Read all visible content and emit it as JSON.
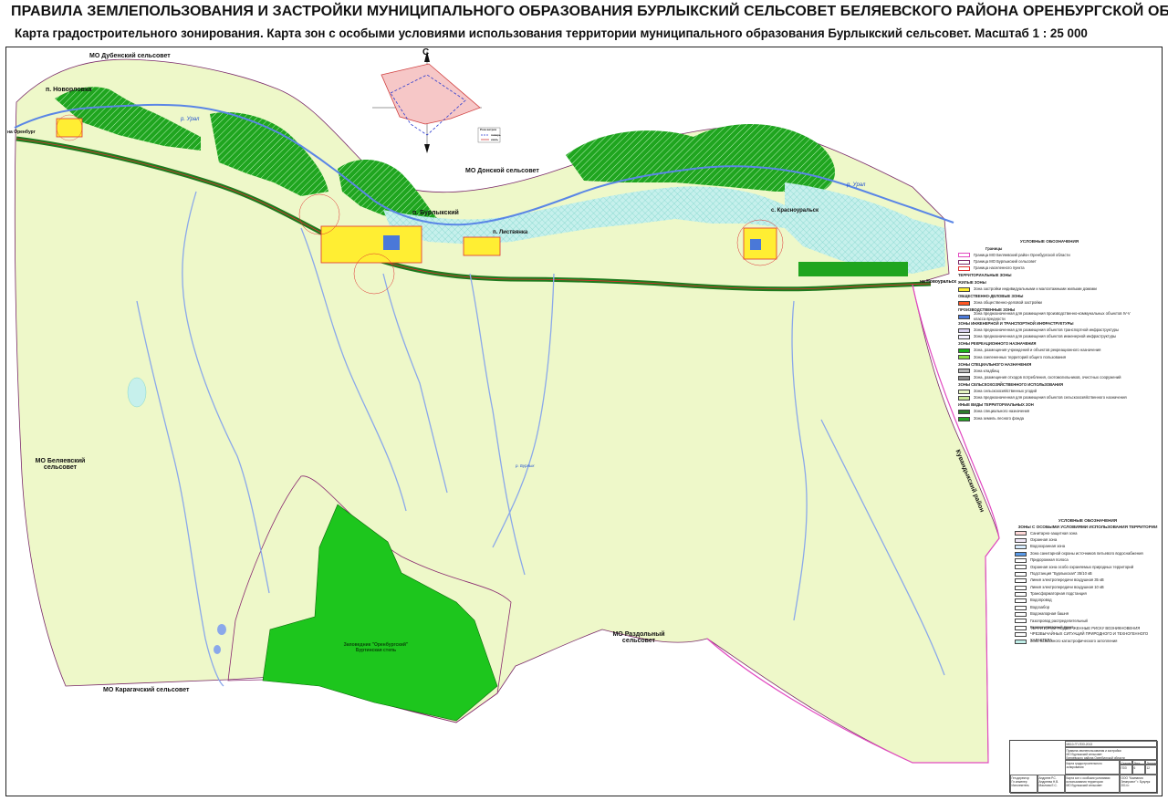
{
  "title": "ПРАВИЛА ЗЕМЛЕПОЛЬЗОВАНИЯ И ЗАСТРОЙКИ МУНИЦИПАЛЬНОГО ОБРАЗОВАНИЯ БУРЛЫКСКИЙ СЕЛЬСОВЕТ БЕЛЯЕВСКОГО РАЙОНА ОРЕНБУРГСКОЙ ОБЛАСТИ",
  "subtitle": "Карта градостроительного зонирования. Карта зон с особыми условиями использования территории муниципального образования Бурлыкский сельсовет. Масштаб 1 : 25 000",
  "map": {
    "neighbors": {
      "dubensky": "МО Дубенский сельсовет",
      "donskoy": "МО Донской сельсовет",
      "belyaevsky": "МО Беляевский сельсовет",
      "karagachsky": "МО Карагачский сельсовет",
      "razdolny": "МО Раздольный сельсовет",
      "kuvandyk": "Кувандыкский район"
    },
    "settlements": {
      "novorlovka": "п. Новорловка",
      "burlyksky": "п. Бурлыкский",
      "listvyanka": "п. Листвянка",
      "krasnouralsk": "с. Красноуральск"
    },
    "rivers": {
      "ural_west": "р. Урал",
      "ural_east": "р. Урал",
      "burlyk": "р. Бурлык"
    },
    "roads": {
      "to_orenburg": "на Оренбург",
      "to_novouralsk": "на Новоуральск"
    },
    "reserve": "Заповедник \"Оренбургский\" Буртинская степь",
    "compass_letter": "С",
    "wind_rose_legend": {
      "title": "Роза ветров",
      "item1": "январь",
      "item2": "июль"
    }
  },
  "legend1": {
    "title": "УСЛОВНЫЕ ОБОЗНАЧЕНИЯ",
    "borders_head": "Границы",
    "borders": [
      {
        "label": "Граница МО Беляевский район Оренбургской области",
        "color": "#e24ac0"
      },
      {
        "label": "Граница МО Бурлыкский сельсовет",
        "color": "#7a2a6a"
      },
      {
        "label": "Граница населенного пункта",
        "color": "#e03030"
      }
    ],
    "zones_head": "ТЕРРИТОРИАЛЬНЫЕ ЗОНЫ",
    "zones": [
      {
        "section": "ЖИЛЫЕ ЗОНЫ",
        "label": "Зона застройки индивидуальными и малоэтажными жилыми домами",
        "color": "#ffee33"
      },
      {
        "section": "ОБЩЕСТВЕННО-ДЕЛОВЫЕ ЗОНЫ",
        "label": "Зона общественно-деловой застройки",
        "color": "#ff5522"
      },
      {
        "section": "ПРОИЗВОДСТВЕННЫЕ ЗОНЫ",
        "label": "Зона предназначенная для размещения производственно-коммунальных объектов IV-V класса вредности",
        "color": "#4a78d8"
      },
      {
        "section": "ЗОНЫ ИНЖЕНЕРНОЙ И ТРАНСПОРТНОЙ ИНФРАСТРУКТУРЫ",
        "label": "Зона предназначенная для размещения объектов транспортной инфраструктуры",
        "color": "#d8d0ee"
      },
      {
        "section": "",
        "label": "Зона предназначенная для размещения объектов инженерной инфраструктуры",
        "color": "#f4f0ff"
      },
      {
        "section": "ЗОНЫ РЕКРЕАЦИОННОГО НАЗНАЧЕНИЯ",
        "label": "Зона, размещения учреждений и объектов рекреационного назначения",
        "color": "#1bb21b"
      },
      {
        "section": "",
        "label": "Зона озелененных территорий общего пользования",
        "color": "#88dd44"
      },
      {
        "section": "ЗОНЫ СПЕЦИАЛЬНОГО НАЗНАЧЕНИЯ",
        "label": "Зона кладбищ",
        "color": "#b8b8b8"
      },
      {
        "section": "",
        "label": "Зона, размещения отходов потребления, скотомогильников, очистных сооружений",
        "color": "#8e8e8e"
      },
      {
        "section": "ЗОНЫ СЕЛЬСКОХОЗЯЙСТВЕННОГО ИСПОЛЬЗОВАНИЯ",
        "label": "Зона сельскохозяйственных угодий",
        "color": "#e6f5c2"
      },
      {
        "section": "",
        "label": "Зона предназначенная для размещения объектов сельскохозяйственного назначения",
        "color": "#c8e896"
      },
      {
        "section": "ИНЫЕ ВИДЫ ТЕРРИТОРИАЛЬНЫХ ЗОН",
        "label": "Зона специального назначения",
        "color": "#2a7a2a"
      },
      {
        "section": "",
        "label": "Зона земель лесного фонда",
        "color": "#22a422"
      }
    ]
  },
  "legend2": {
    "title": "УСЛОВНЫЕ ОБОЗНАЧЕНИЯ",
    "subtitle": "ЗОНЫ С ОСОБЫМИ УСЛОВИЯМИ ИСПОЛЬЗОВАНИЯ ТЕРРИТОРИИ",
    "items": [
      {
        "label": "Санитарно-защитная зона",
        "color": "#ffd8d8"
      },
      {
        "label": "Охранная зона",
        "color": "#f0e8f8"
      },
      {
        "label": "Водоохранная зона",
        "color": "#d8ecff"
      },
      {
        "label": "Зона санитарной охраны источников питьевого водоснабжения",
        "color": "#5a9ae8"
      },
      {
        "label": "Придорожная полоса",
        "color": "#ffffff"
      },
      {
        "label": "Охранная зона особо охраняемых природных территорий",
        "color": "#ffffff"
      },
      {
        "label": "Подстанция \"Бурлыкская\" 35/10 кВ",
        "color": "#ffffff"
      },
      {
        "label": "Линия электропередачи воздушная 35 кВ",
        "color": "#ffffff"
      },
      {
        "label": "Линия электропередачи воздушная 10 кВ",
        "color": "#ffffff"
      },
      {
        "label": "Трансформаторная подстанция",
        "color": "#ffffff"
      },
      {
        "label": "Водопровод",
        "color": "#ffffff"
      },
      {
        "label": "Водозабор",
        "color": "#ffffff"
      },
      {
        "label": "Водонапорная башня",
        "color": "#ffffff"
      },
      {
        "label": "Газопровод распределительный",
        "color": "#ffffff"
      },
      {
        "label": "Газорегуляторный пункт",
        "color": "#ffffff"
      },
      {
        "label": "ТЕРРИТОРИИ ПОДВЕРЖЕННЫЕ РИСКУ ВОЗНИКНОВЕНИЯ ЧРЕЗВЫЧАЙНЫХ СИТУАЦИЙ ПРИРОДНОГО И ТЕХНОГЕННОГО ХАРАКТЕРА",
        "color": "#ffffff"
      },
      {
        "label": "Зона возможного катастрофического затопления",
        "color": "#bfeee8"
      }
    ]
  },
  "stamp": {
    "code": "МК10-ГП-ПЗЗ-2013",
    "org_line1": "Правила землепользования и застройки",
    "org_line2": "МО Бурлыкский сельсовет",
    "org_line3": "Беляевского района Оренбургской области",
    "stage_head": "Стадия",
    "sheet_head": "Лист",
    "sheets_head": "Листов",
    "stage": "ПЗЗ",
    "sheet": "6",
    "sheets": "12",
    "sheet_title": "Карта градостроительного зонирования",
    "sheet_sub1": "Карта зон с особыми условиями",
    "sheet_sub2": "использования территории",
    "sheet_sub3": "МО Бурлыкский сельсовет",
    "company": "ООО \"Компания Земпроект\" г. Бузулук 2014 г.",
    "roles": [
      "Ген.директор",
      "Гл.инженер",
      "Исполнитель"
    ],
    "names": [
      "Андреев Р.С.",
      "Андреева Н.В.",
      "Маслова Е.С."
    ]
  }
}
